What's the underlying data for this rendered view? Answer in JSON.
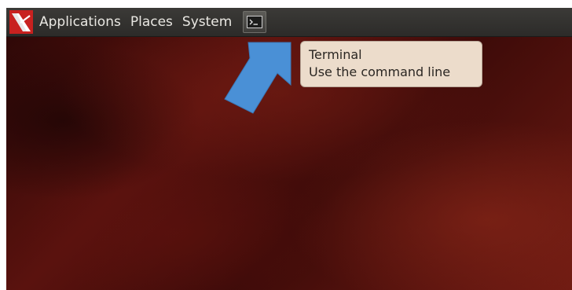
{
  "panel": {
    "menus": [
      {
        "label": "Applications"
      },
      {
        "label": "Places"
      },
      {
        "label": "System"
      }
    ],
    "launcher_icon": "terminal-icon",
    "logo_icon": "distro-logo-icon"
  },
  "tooltip": {
    "title": "Terminal",
    "description": "Use the command line"
  },
  "colors": {
    "panel_bg": "#2e2d2b",
    "tooltip_bg": "#ecdccb",
    "arrow": "#4a90d6",
    "desktop": "#4a0e0b"
  }
}
